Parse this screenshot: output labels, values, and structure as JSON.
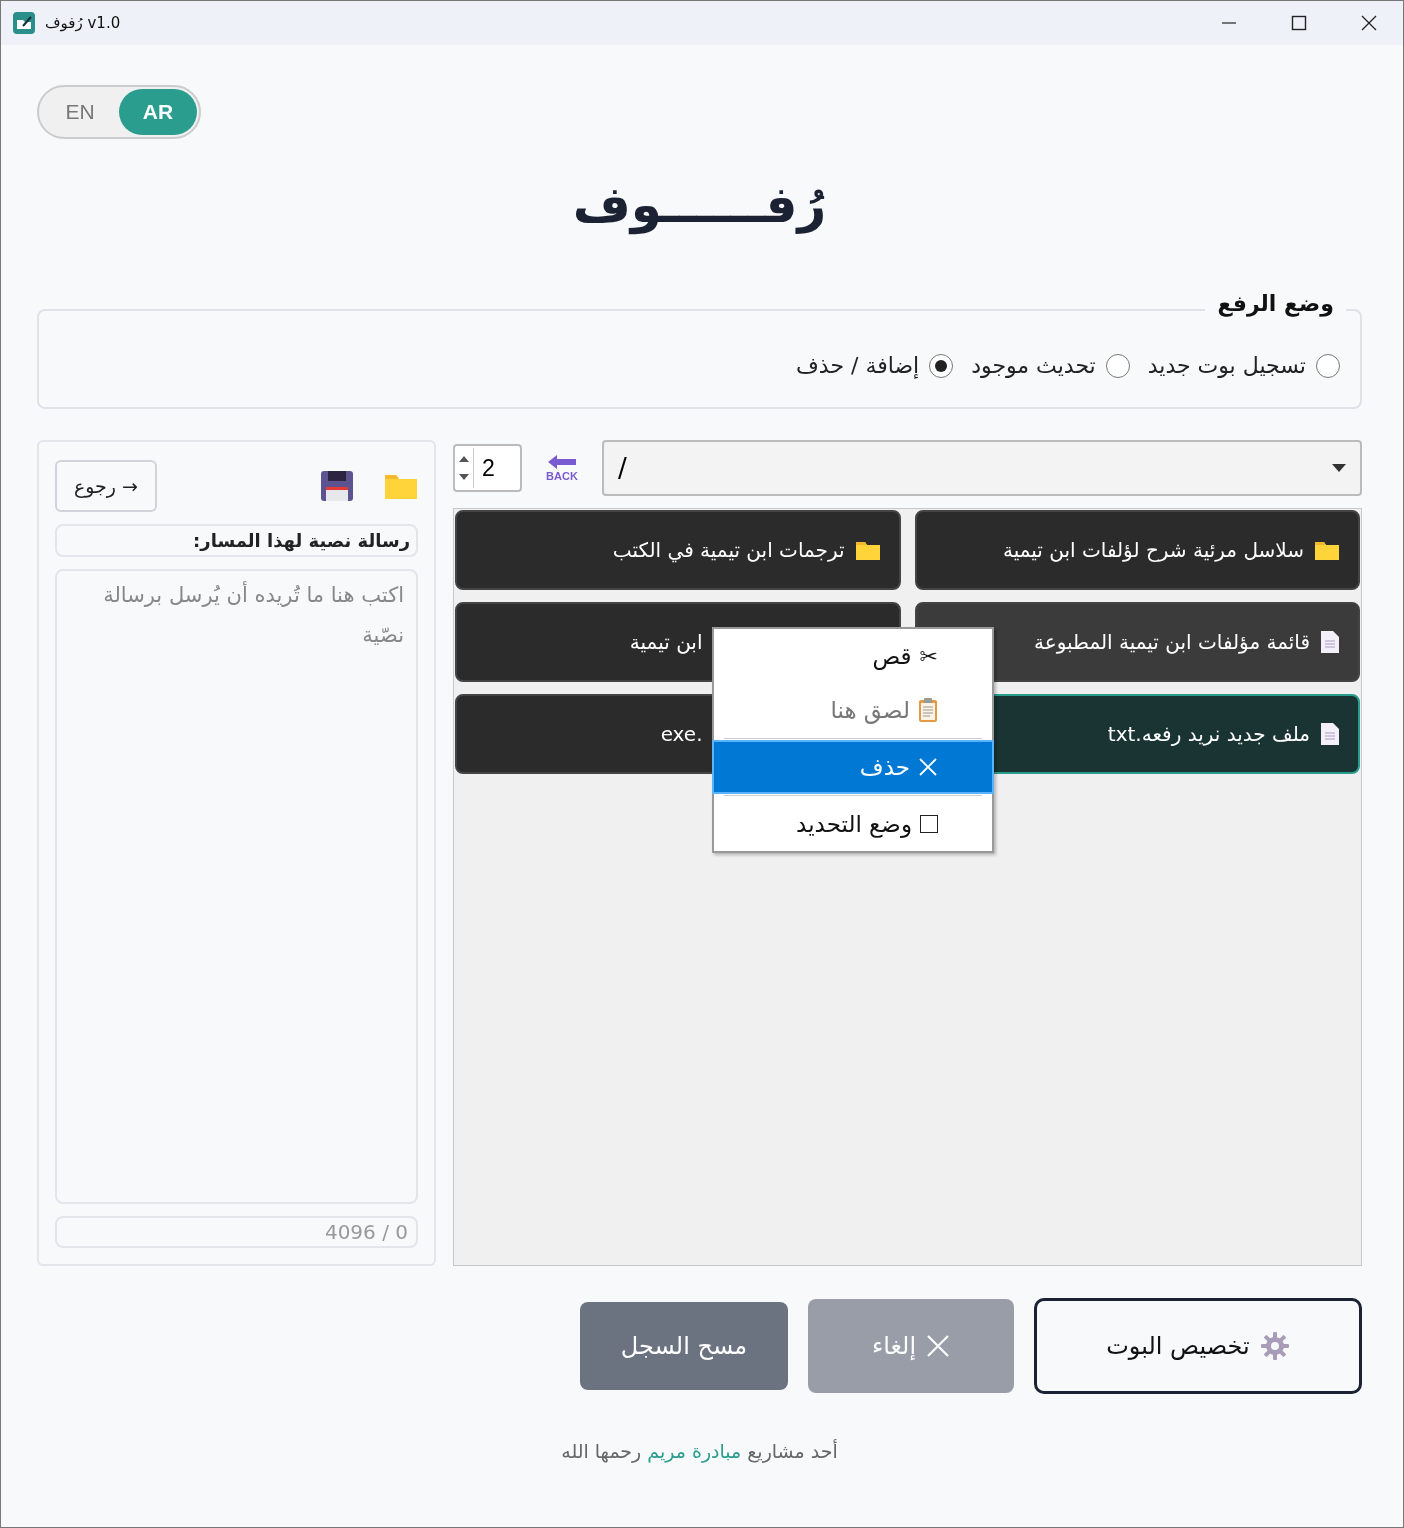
{
  "window": {
    "title": "رُفوف v1.0"
  },
  "language_toggle": [
    {
      "label": "AR",
      "selected": true
    },
    {
      "label": "EN",
      "selected": false
    }
  ],
  "app_title": "رُفــــــوف",
  "upload_mode": {
    "legend": "وضع الرفع",
    "options": [
      {
        "label": "تسجيل بوت جديد",
        "selected": false
      },
      {
        "label": "تحديث موجود",
        "selected": false
      },
      {
        "label": "إضافة / حذف",
        "selected": true
      }
    ]
  },
  "side_panel": {
    "back_button": "→ رجوع",
    "message_label": "رسالة نصية لهذا المسار:",
    "message": {
      "placeholder": "اكتب هنا ما تُريده أن يُرسل برسالة نصّية"
    },
    "counter": "0 / 4096"
  },
  "toolbar": {
    "columns_spinner": "2",
    "back_icon_label": "BACK",
    "path": "/"
  },
  "tiles": [
    {
      "kind": "folder",
      "label": "سلاسل مرئية شرح لؤلفات ابن تيمية",
      "selected": false
    },
    {
      "kind": "folder",
      "label": "ترجمات ابن تيمية في الكتب",
      "selected": false
    },
    {
      "kind": "file",
      "label": "قائمة مؤلفات ابن تيمية المطبوعة",
      "selected": false
    },
    {
      "kind": "none",
      "label": "ابن تيمية",
      "selected": false
    },
    {
      "kind": "file",
      "label": "ملف جديد نريد رفعه.txt",
      "selected": true
    },
    {
      "kind": "none",
      "label": ".exe",
      "selected": false
    }
  ],
  "context_menu": [
    {
      "kind": "cut",
      "icon": "✂",
      "label": "قص",
      "disabled": false,
      "selected": false
    },
    {
      "kind": "paste",
      "label": "لصق هنا",
      "disabled": true,
      "selected": false
    },
    {
      "kind": "delete",
      "label": "حذف",
      "disabled": false,
      "selected": true
    },
    {
      "kind": "check",
      "label": "وضع التحديد",
      "disabled": false,
      "selected": false,
      "checked": false
    }
  ],
  "buttons": [
    {
      "kind": "customize",
      "label": "تخصيص البوت",
      "disabled": false
    },
    {
      "kind": "cancel",
      "label": "إلغاء",
      "disabled": true
    },
    {
      "kind": "clear",
      "label": "مسح السجل",
      "disabled": false
    }
  ],
  "footer": {
    "before": "أحد مشاريع",
    "link": "مبادرة مريم",
    "after": "رحمها الله"
  }
}
